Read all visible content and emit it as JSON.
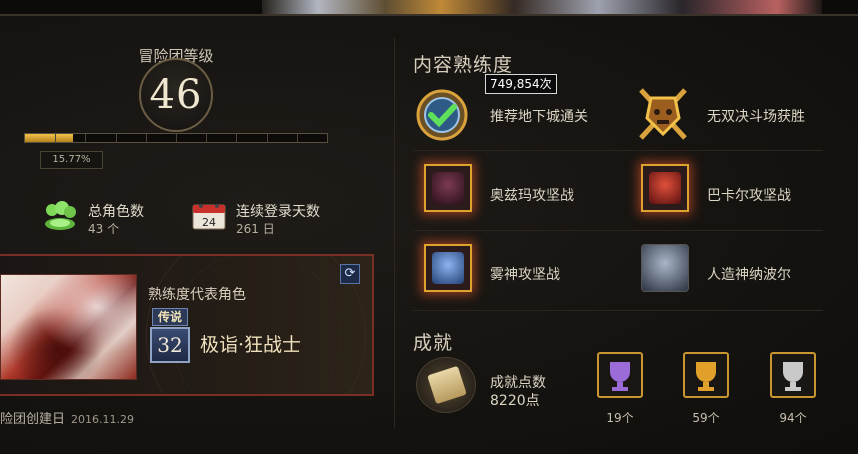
{
  "profile": {
    "level_title": "冒险团等级",
    "level": "46",
    "xp_percent_label": "15.77%",
    "xp_fraction": 0.1577,
    "stats": [
      {
        "icon": "character-group-icon",
        "title": "总角色数",
        "value": "43 个"
      },
      {
        "icon": "calendar-icon",
        "title": "连续登录天数",
        "value": "261 日",
        "calendar_day": "24"
      }
    ]
  },
  "representative": {
    "title": "熟练度代表角色",
    "rank_badge": "传说",
    "char_level": "32",
    "char_name": "极诣·狂战士",
    "refresh_glyph": "⟳",
    "created_label": "险团创建日",
    "created_date": "2016.11.29"
  },
  "proficiency": {
    "section_title": "内容熟练度",
    "tooltip": "749,854次",
    "items": [
      {
        "icon": "dungeon-clear-icon",
        "label": "推荐地下城通关"
      },
      {
        "icon": "arena-victory-icon",
        "label": "无双决斗场获胜"
      },
      {
        "icon": "ozma-raid-icon",
        "label": "奥兹玛攻坚战"
      },
      {
        "icon": "bakal-raid-icon",
        "label": "巴卡尔攻坚战"
      },
      {
        "icon": "misty-god-raid-icon",
        "label": "雾神攻坚战"
      },
      {
        "icon": "artificial-god-nabel-icon",
        "label": "人造神纳波尔"
      }
    ]
  },
  "achievements": {
    "section_title": "成就",
    "points_label": "成就点数",
    "points_value": "8220点",
    "trophies": [
      {
        "icon": "purple-trophy-icon",
        "count": "19个",
        "color": "#9b6bd8"
      },
      {
        "icon": "gold-trophy-icon",
        "count": "59个",
        "color": "#e0a02a"
      },
      {
        "icon": "silver-trophy-icon",
        "count": "94个",
        "color": "#c9c9c9"
      }
    ]
  }
}
